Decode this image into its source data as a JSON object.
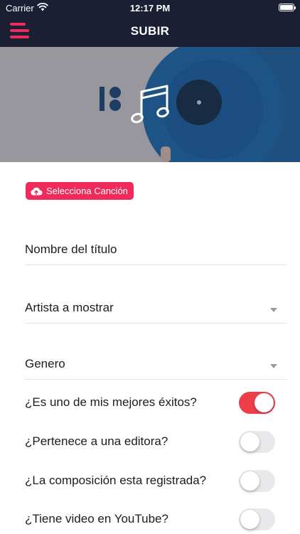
{
  "status_bar": {
    "carrier": "Carrier",
    "time": "12:17 PM",
    "battery_level": 1.0,
    "wifi_icon": "wifi-icon",
    "battery_icon": "battery-icon"
  },
  "nav": {
    "title": "SUBIR",
    "menu_icon": "hamburger-menu-icon"
  },
  "hero": {
    "image": "vinyl-record-photo",
    "icon": "music-note-icon"
  },
  "select_song": {
    "label": "Selecciona Canción",
    "icon": "cloud-upload-icon"
  },
  "form": {
    "title_field": {
      "placeholder": "Nombre del título"
    },
    "artist_field": {
      "placeholder": "Artista a mostrar",
      "icon": "dropdown-arrow-icon"
    },
    "genre_field": {
      "placeholder": "Genero",
      "icon": "dropdown-arrow-icon"
    }
  },
  "toggles": [
    {
      "label": "¿Es uno de mis mejores éxitos?",
      "on": true
    },
    {
      "label": "¿Pertenece a una editora?",
      "on": false
    },
    {
      "label": "¿La composición esta registrada?",
      "on": false
    },
    {
      "label": "¿Tiene video en YouTube?",
      "on": false
    }
  ],
  "colors": {
    "accent": "#ee2b5a",
    "switch_on": "#ee3e4c",
    "nav_background": "#1b1f33"
  }
}
